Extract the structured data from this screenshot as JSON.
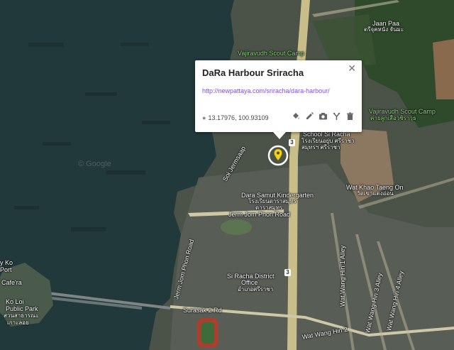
{
  "place": {
    "title": "DaRa Harbour Sriracha",
    "link": "http://newpattaya.com/sriracha/dara-harbour/",
    "coords": "13.17976, 100.93109"
  },
  "tools": [
    "fill-icon",
    "edit-icon",
    "camera-icon",
    "directions-icon",
    "delete-icon"
  ],
  "labels": {
    "scout1": "Vajiravudh Scout Camp",
    "jaan_paa": "Jaan Paa",
    "jaan_paa_th": "ตรีจุคหนัง จันมะ",
    "scout2": "Vajiravudh Scout Camp",
    "scout2_th": "ค่ายลูกเสือวชิราวุธ",
    "school": "School Si Racha",
    "school_th": "โรงเรียนอยู่บ ศรีราชา",
    "school_th2": "สมุทรฯ ศรีราชา",
    "kindergarten": "Dara Samut Kindergarten",
    "kindergarten_th": "โรงเรียนดาราสมุทร",
    "kindergarten_th2": "ดาราสมุทร",
    "wat_khao": "Wat Khao Taeng On",
    "wat_khao_th": "วัดเขาแตงอ่อน",
    "jerm_jom_road": "Jerm Jom Phon Road",
    "soi_jermsaap": "Soi Jermsaap",
    "jerm_jom_rd_vert": "Jerm Jom Phon Road",
    "district": "Si Racha District",
    "district2": "Office",
    "district_th": "อำเภอศรีราชา",
    "surasak": "Surasak 2 Rd",
    "wat_wang_hin2": "Wat Wang Hin 2",
    "wat_wang_hin1": "Wat Wang Hin 1 Alley",
    "wat_wang_hin3": "Wat Wang Hin 3 Alley",
    "wat_wang_hin4": "Wat Wang Hin 4 Alley",
    "kokoi": "Ko Loi",
    "kokoi2": "Public Park",
    "kokoi_th": "สวนสาธารณะ",
    "kokoi_th2": "เกาะลอย",
    "ko_port": "y Ko",
    "ko_port2": "Port",
    "cafe": "Cafe'ra",
    "shield3": "3"
  },
  "colors": {
    "sea": "#22393b",
    "land": "#4a5248",
    "road": "#d9cf9a",
    "marker": "#f2d21b"
  }
}
